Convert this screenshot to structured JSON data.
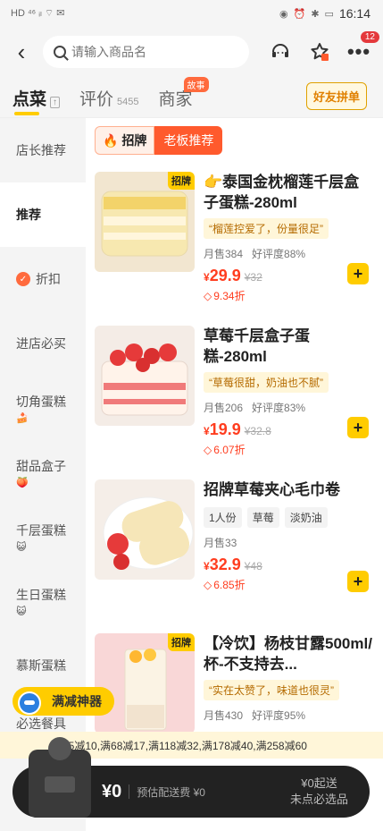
{
  "status_bar": {
    "left_icons": "HD ⁴⁶ ᵢₗ ⌔ ✉",
    "time": "16:14"
  },
  "top_bar": {
    "search_placeholder": "请输入商品名",
    "message_badge": "12"
  },
  "tabs": {
    "order": "点菜",
    "review": "评价",
    "review_count": "5455",
    "merchant": "商家",
    "merchant_tag": "故事",
    "group_order": "好友拼单"
  },
  "sidebar": {
    "items": [
      {
        "label": "店长推荐"
      },
      {
        "label": "推荐"
      },
      {
        "label": "折扣"
      },
      {
        "label": "进店必买"
      },
      {
        "label": "切角蛋糕",
        "emoji": "🍰"
      },
      {
        "label": "甜品盒子",
        "emoji": "🍑"
      },
      {
        "label": "千层蛋糕",
        "emoji": "😺"
      },
      {
        "label": "生日蛋糕",
        "emoji": "😺"
      },
      {
        "label": "慕斯蛋糕"
      },
      {
        "label": "必选餐具",
        "emoji": "🍀"
      }
    ]
  },
  "section": {
    "left": "招牌",
    "right": "老板推荐"
  },
  "products": [
    {
      "tag": "招牌",
      "name": "👉泰国金枕榴莲千层盒子蛋糕-280ml",
      "quote": "“榴莲控爱了，份量很足”",
      "monthly_sales": "月售384",
      "rating": "好评度88%",
      "price": "29.9",
      "original": "¥32",
      "discount": "9.34折"
    },
    {
      "tag": "",
      "name": "草莓千层盒子蛋糕-280ml",
      "quote": "“草莓很甜，奶油也不腻”",
      "monthly_sales": "月售206",
      "rating": "好评度83%",
      "price": "19.9",
      "original": "¥32.8",
      "discount": "6.07折"
    },
    {
      "tag": "",
      "name": "招牌草莓夹心毛巾卷",
      "chips": [
        "1人份",
        "草莓",
        "淡奶油"
      ],
      "monthly_sales": "月售33",
      "rating": "",
      "price": "32.9",
      "original": "¥48",
      "discount": "6.85折"
    },
    {
      "tag": "招牌",
      "name": "【冷饮】杨枝甘露500ml/杯-不支持去...",
      "quote": "“实在太赞了，味道也很灵”",
      "monthly_sales": "月售430",
      "rating": "好评度95%"
    }
  ],
  "promo": {
    "floating": "满减神器",
    "bar": "满45减10,满68减17,满118减32,满178减40,满258减60"
  },
  "cart": {
    "total": "¥0",
    "delivery": "预估配送费 ¥0",
    "min_order": "¥0起送",
    "notice": "未点必选品"
  },
  "colors": {
    "accent": "#ffcc00",
    "price": "#ff3d1f",
    "tag_orange": "#ff5a2d"
  }
}
